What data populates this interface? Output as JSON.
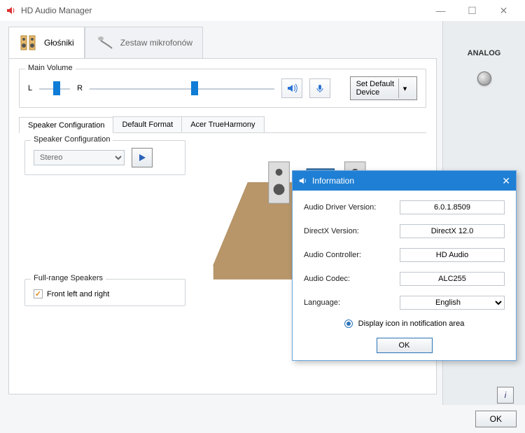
{
  "window": {
    "title": "HD Audio Manager"
  },
  "devices": {
    "tabs": [
      {
        "label": "Głośniki",
        "active": true
      },
      {
        "label": "Zestaw mikrofonów",
        "active": false
      }
    ]
  },
  "volume": {
    "legend": "Main Volume",
    "balance_left": "L",
    "balance_right": "R",
    "balance_pos_pct": 45,
    "level_pos_pct": 55,
    "set_default_label": "Set Default\nDevice"
  },
  "sidebar": {
    "label": "ANALOG"
  },
  "sub_tabs": [
    {
      "label": "Speaker Configuration",
      "active": true
    },
    {
      "label": "Default Format",
      "active": false
    },
    {
      "label": "Acer TrueHarmony",
      "active": false
    }
  ],
  "speaker_config": {
    "legend": "Speaker Configuration",
    "selected": "Stereo"
  },
  "full_range": {
    "legend": "Full-range Speakers",
    "items": [
      {
        "label": "Front left and right",
        "checked": true
      }
    ]
  },
  "bottom": {
    "ok": "OK"
  },
  "modal": {
    "title": "Information",
    "rows": [
      {
        "k": "Audio Driver Version:",
        "v": "6.0.1.8509"
      },
      {
        "k": "DirectX Version:",
        "v": "DirectX 12.0"
      },
      {
        "k": "Audio Controller:",
        "v": "HD Audio"
      },
      {
        "k": "Audio Codec:",
        "v": "ALC255"
      }
    ],
    "language_label": "Language:",
    "language_value": "English",
    "notification_label": "Display icon in notification area",
    "notification_on": true,
    "ok": "OK"
  }
}
